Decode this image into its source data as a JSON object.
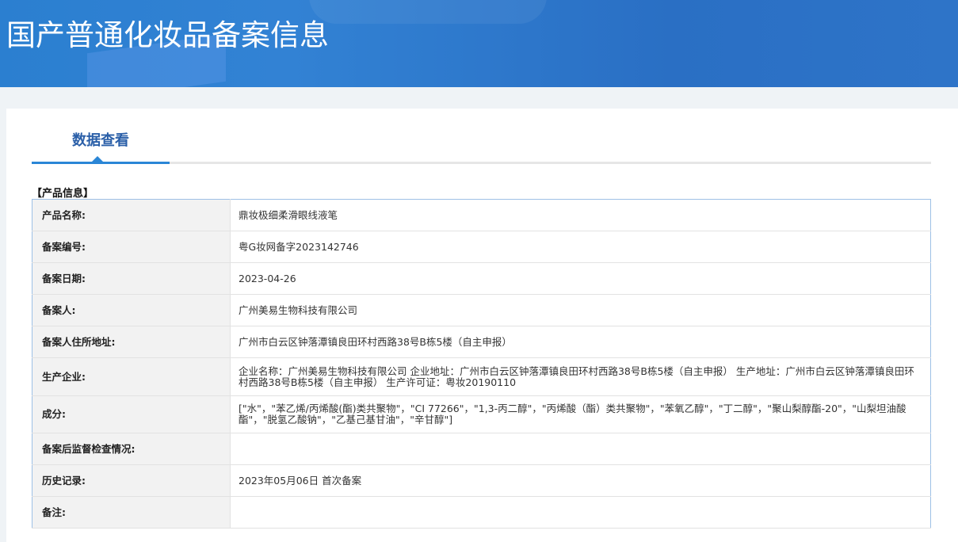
{
  "header": {
    "title": "国产普通化妆品备案信息"
  },
  "tabs": [
    {
      "label": "数据查看",
      "active": true
    }
  ],
  "section_title": "【产品信息】",
  "rows": [
    {
      "label": "产品名称:",
      "value": "鼎妆极细柔滑眼线液笔"
    },
    {
      "label": "备案编号:",
      "value": "粤G妆网备字2023142746"
    },
    {
      "label": "备案日期:",
      "value": "2023-04-26"
    },
    {
      "label": "备案人:",
      "value": "广州美易生物科技有限公司"
    },
    {
      "label": "备案人住所地址:",
      "value": "广州市白云区钟落潭镇良田环村西路38号B栋5楼（自主申报）"
    },
    {
      "label": "生产企业:",
      "value": "企业名称：广州美易生物科技有限公司 企业地址：广州市白云区钟落潭镇良田环村西路38号B栋5楼（自主申报） 生产地址：广州市白云区钟落潭镇良田环村西路38号B栋5楼（自主申报） 生产许可证：粤妆20190110"
    },
    {
      "label": "成分:",
      "value": "[\"水\"，\"苯乙烯/丙烯酸(酯)类共聚物\"，\"CI 77266\"，\"1,3-丙二醇\"，\"丙烯酸（酯）类共聚物\"，\"苯氧乙醇\"，\"丁二醇\"，\"聚山梨醇酯-20\"，\"山梨坦油酸酯\"，\"脱氢乙酸钠\"，\"乙基己基甘油\"，\"辛甘醇\"]"
    },
    {
      "label": "备案后监督检查情况:",
      "value": ""
    },
    {
      "label": "历史记录:",
      "value": "2023年05月06日 首次备案"
    },
    {
      "label": "备注:",
      "value": ""
    }
  ]
}
